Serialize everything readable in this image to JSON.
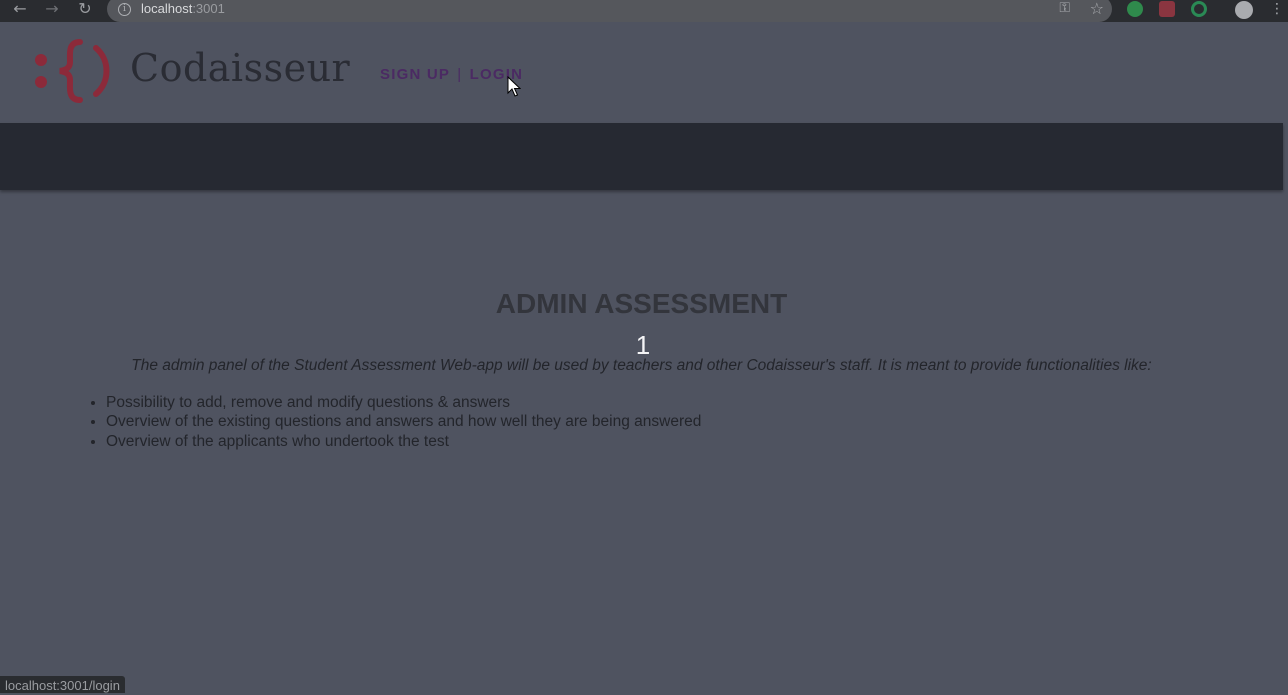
{
  "browser": {
    "url_host": "localhost",
    "url_port": ":3001",
    "status_url": "localhost:3001/login"
  },
  "header": {
    "brand": "Codaisseur",
    "signup_label": "SIGN UP",
    "separator": "|",
    "login_label": "LOGIN"
  },
  "content": {
    "title": "ADMIN ASSESSMENT",
    "slide_number": "1",
    "intro": "The admin panel of the Student Assessment Web-app will be used by teachers and other Codaisseur's staff. It is meant to provide functionalities like:",
    "features": [
      "Possibility to add, remove and modify questions & answers",
      "Overview of the existing questions and answers and how well they are being answered",
      "Overview of the applicants who undertook the test"
    ]
  },
  "icons": {
    "back": "arrow-left-icon",
    "forward": "arrow-right-icon",
    "reload": "reload-icon",
    "info": "info-icon",
    "key": "key-icon",
    "star": "star-icon",
    "menu": "kebab-menu-icon",
    "cursor": "mouse-pointer-icon"
  },
  "colors": {
    "brand_red": "#8c2a3a",
    "link_purple": "#4b2a63",
    "band": "#262932",
    "background": "#4f5360"
  }
}
